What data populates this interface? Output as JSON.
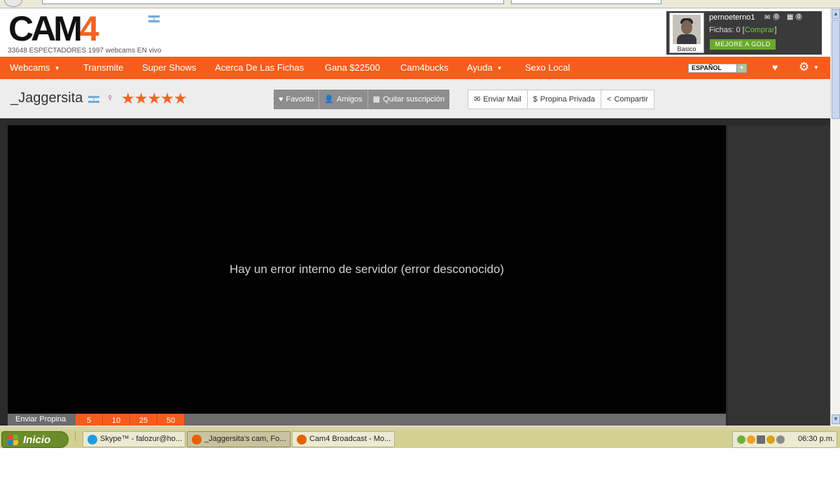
{
  "header": {
    "logo_main": "CAM",
    "logo_accent": "4",
    "stats": "33648 ESPECTADORES   1997 webcams EN vivo"
  },
  "user": {
    "avatar_label": "Basico",
    "username": "pernoeterno1",
    "mail_count": "0",
    "calendar_count": "0",
    "fichas_label": "Fichas: 0 [",
    "fichas_link": "Comprar",
    "fichas_end": "]",
    "gold_button": "MEJORE A GOLD"
  },
  "nav": {
    "items": [
      {
        "label": "Webcams",
        "has_caret": true
      },
      {
        "label": "Transmite",
        "has_caret": false
      },
      {
        "label": "Super Shows",
        "has_caret": false
      },
      {
        "label": "Acerca De Las Fichas",
        "has_caret": false
      },
      {
        "label": "Gana $22500",
        "has_caret": false
      },
      {
        "label": "Cam4bucks",
        "has_caret": false
      },
      {
        "label": "Ayuda",
        "has_caret": true
      },
      {
        "label": "Sexo Local",
        "has_caret": false
      }
    ],
    "language": "ESPAÑOL"
  },
  "profile": {
    "name": "_Jaggersita",
    "gender_icon": "female-icon",
    "stars": "★★★★★",
    "subscription_buttons": [
      "Favorito",
      "Amigos",
      "Quitar suscripción"
    ],
    "action_buttons": [
      "Enviar Mail",
      "Propina Privada",
      "Compartir"
    ]
  },
  "player": {
    "error_message": "Hay un error interno de servidor (error desconocido)",
    "tip_label": "Enviar Propina",
    "tip_amounts": [
      "5",
      "10",
      "25",
      "50"
    ]
  },
  "taskbar": {
    "start_label": "Inicio",
    "tasks": [
      {
        "label": "Skype™ - falozur@ho...",
        "icon": "skype-icon",
        "active": false
      },
      {
        "label": "_Jaggersita's cam, Fo...",
        "icon": "firefox-icon",
        "active": true
      },
      {
        "label": "Cam4 Broadcast - Mo...",
        "icon": "firefox-icon",
        "active": false
      }
    ],
    "clock": "06:30 p.m."
  },
  "colors": {
    "brand_orange": "#f65d1d",
    "gold_green": "#6aa92a",
    "star_orange": "#f36421"
  }
}
